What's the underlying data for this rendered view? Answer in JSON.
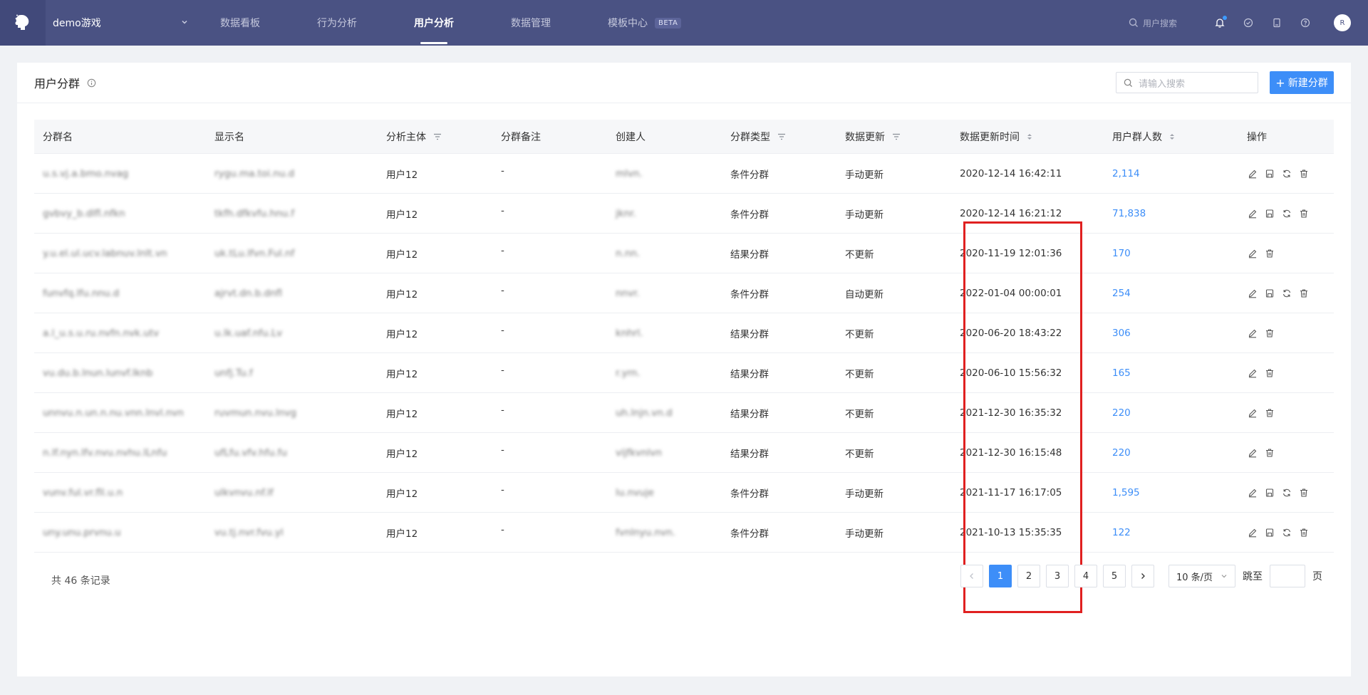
{
  "topbar": {
    "project_name": "demo游戏",
    "nav": [
      {
        "label": "数据看板"
      },
      {
        "label": "行为分析"
      },
      {
        "label": "用户分析",
        "active": true
      },
      {
        "label": "数据管理"
      },
      {
        "label": "模板中心",
        "badge": "BETA"
      }
    ],
    "user_search_placeholder": "用户搜索",
    "avatar_initial": "R"
  },
  "page": {
    "title": "用户分群",
    "search_placeholder": "请输入搜索",
    "new_button_label": "新建分群"
  },
  "table": {
    "columns": [
      "分群名",
      "显示名",
      "分析主体",
      "分群备注",
      "创建人",
      "分群类型",
      "数据更新",
      "数据更新时间",
      "用户群人数",
      "操作"
    ],
    "rows": [
      {
        "name": "u.s.vj.a.bmo.nvag",
        "display": "rygu.ma.toi.nu.d",
        "subject": "用户12",
        "note": "-",
        "creator": "mlvn.",
        "type": "条件分群",
        "update": "手动更新",
        "time": "2020-12-14 16:42:11",
        "count": "2,114",
        "ops": [
          "edit",
          "save",
          "refresh",
          "delete"
        ]
      },
      {
        "name": "gvbvy_b.dlfl.nfkn",
        "display": "tkfh.dfkvfu.hnu.f",
        "subject": "用户12",
        "note": "-",
        "creator": "jknr.",
        "type": "条件分群",
        "update": "手动更新",
        "time": "2020-12-14 16:21:12",
        "count": "71,838",
        "ops": [
          "edit",
          "save",
          "refresh",
          "delete"
        ]
      },
      {
        "name": "y.u.el.ul.ucv.labnuv.lnlt.vn",
        "display": "uk.tLu.lfvn.Ful.nf",
        "subject": "用户12",
        "note": "-",
        "creator": "n.nn.",
        "type": "结果分群",
        "update": "不更新",
        "time": "2020-11-19 12:01:36",
        "count": "170",
        "ops": [
          "edit",
          "delete"
        ]
      },
      {
        "name": "funvfq.lfu.nnu.d",
        "display": "ajrvt.dn.b.dnfl",
        "subject": "用户12",
        "note": "-",
        "creator": "nnvr.",
        "type": "条件分群",
        "update": "自动更新",
        "time": "2022-01-04 00:00:01",
        "count": "254",
        "ops": [
          "edit",
          "save",
          "refresh",
          "delete"
        ]
      },
      {
        "name": "a.l_u.s.u.ru.nvfn.nvk.utv",
        "display": "u.lk.uaf.nfu.Lv",
        "subject": "用户12",
        "note": "-",
        "creator": "knhrl.",
        "type": "结果分群",
        "update": "不更新",
        "time": "2020-06-20 18:43:22",
        "count": "306",
        "ops": [
          "edit",
          "delete"
        ]
      },
      {
        "name": "vu.du.b.lnun.lunvf.lknb",
        "display": "unfj.Tu.f",
        "subject": "用户12",
        "note": "-",
        "creator": "r.yrn.",
        "type": "结果分群",
        "update": "不更新",
        "time": "2020-06-10 15:56:32",
        "count": "165",
        "ops": [
          "edit",
          "delete"
        ]
      },
      {
        "name": "unnvu.n.un.n.nu.vnn.lnvl.nvn",
        "display": "ruvmun.nvu.lnvg",
        "subject": "用户12",
        "note": "-",
        "creator": "uh.lnjn.vn.d",
        "type": "结果分群",
        "update": "不更新",
        "time": "2021-12-30 16:35:32",
        "count": "220",
        "ops": [
          "edit",
          "delete"
        ]
      },
      {
        "name": "n.lf.nyn.lfv.nvu.nvhu.lLnfu",
        "display": "ufLfu.vfv.hfu.fu",
        "subject": "用户12",
        "note": "-",
        "creator": "vijfkvnlvn",
        "type": "结果分群",
        "update": "不更新",
        "time": "2021-12-30 16:15:48",
        "count": "220",
        "ops": [
          "edit",
          "delete"
        ]
      },
      {
        "name": "vunv.ful.vr.fll.u.n",
        "display": "ulkvnvu.nf.lf",
        "subject": "用户12",
        "note": "-",
        "creator": "lu.nvuje",
        "type": "条件分群",
        "update": "手动更新",
        "time": "2021-11-17 16:17:05",
        "count": "1,595",
        "ops": [
          "edit",
          "save",
          "refresh",
          "delete"
        ]
      },
      {
        "name": "uny.unu.prvnu.u",
        "display": "vu.tj.nvr.fvu.yl",
        "subject": "用户12",
        "note": "-",
        "creator": "fvnlnyu.nvn.",
        "type": "条件分群",
        "update": "手动更新",
        "time": "2021-10-13 15:35:35",
        "count": "122",
        "ops": [
          "edit",
          "save",
          "refresh",
          "delete"
        ]
      }
    ]
  },
  "pagination": {
    "total_text": "共 46 条记录",
    "pages": [
      "1",
      "2",
      "3",
      "4",
      "5"
    ],
    "current": "1",
    "page_size": "10 条/页",
    "jump_label": "跳至",
    "jump_suffix": "页"
  },
  "colors": {
    "topbar": "#4a5283",
    "accent": "#3d8ef8",
    "highlight": "#e02020"
  }
}
